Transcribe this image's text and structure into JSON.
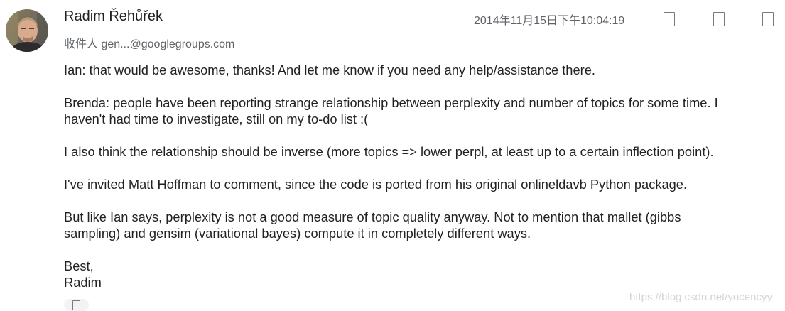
{
  "message": {
    "sender_name": "Radim Řehůřek",
    "recipient_prefix": "收件人",
    "recipient_address": "gen...@googlegroups.com",
    "timestamp": "2014年11月15日下午10:04:19",
    "header_icons": [
      "star-icon",
      "reply-icon",
      "more-icon"
    ],
    "body": {
      "p1": "Ian: that would be awesome, thanks! And let me know if you need any help/assistance there.",
      "p2_line1": "Brenda: people have been reporting strange relationship between perplexity and number of topics for some time. I",
      "p2_line2": "haven't had time to investigate, still on my to-do list :(",
      "p3": "I also think the relationship should be inverse (more topics => lower perpl, at least up to a certain inflection point).",
      "p4": "I've invited Matt Hoffman to comment, since the code is ported from his original onlineldavb Python package.",
      "p5_line1": "But like Ian says, perplexity is not a good measure of topic quality anyway. Not to mention that mallet (gibbs",
      "p5_line2": "sampling) and gensim (variational bayes) compute it in completely different ways.",
      "closing": "Best,",
      "signature": "Radim"
    }
  },
  "watermark": "https://blog.csdn.net/yocencyy",
  "colors": {
    "text": "#222222",
    "meta": "#5f6368",
    "trim_button_bg": "#f1f3f4",
    "watermark": "#d4d4d4"
  }
}
